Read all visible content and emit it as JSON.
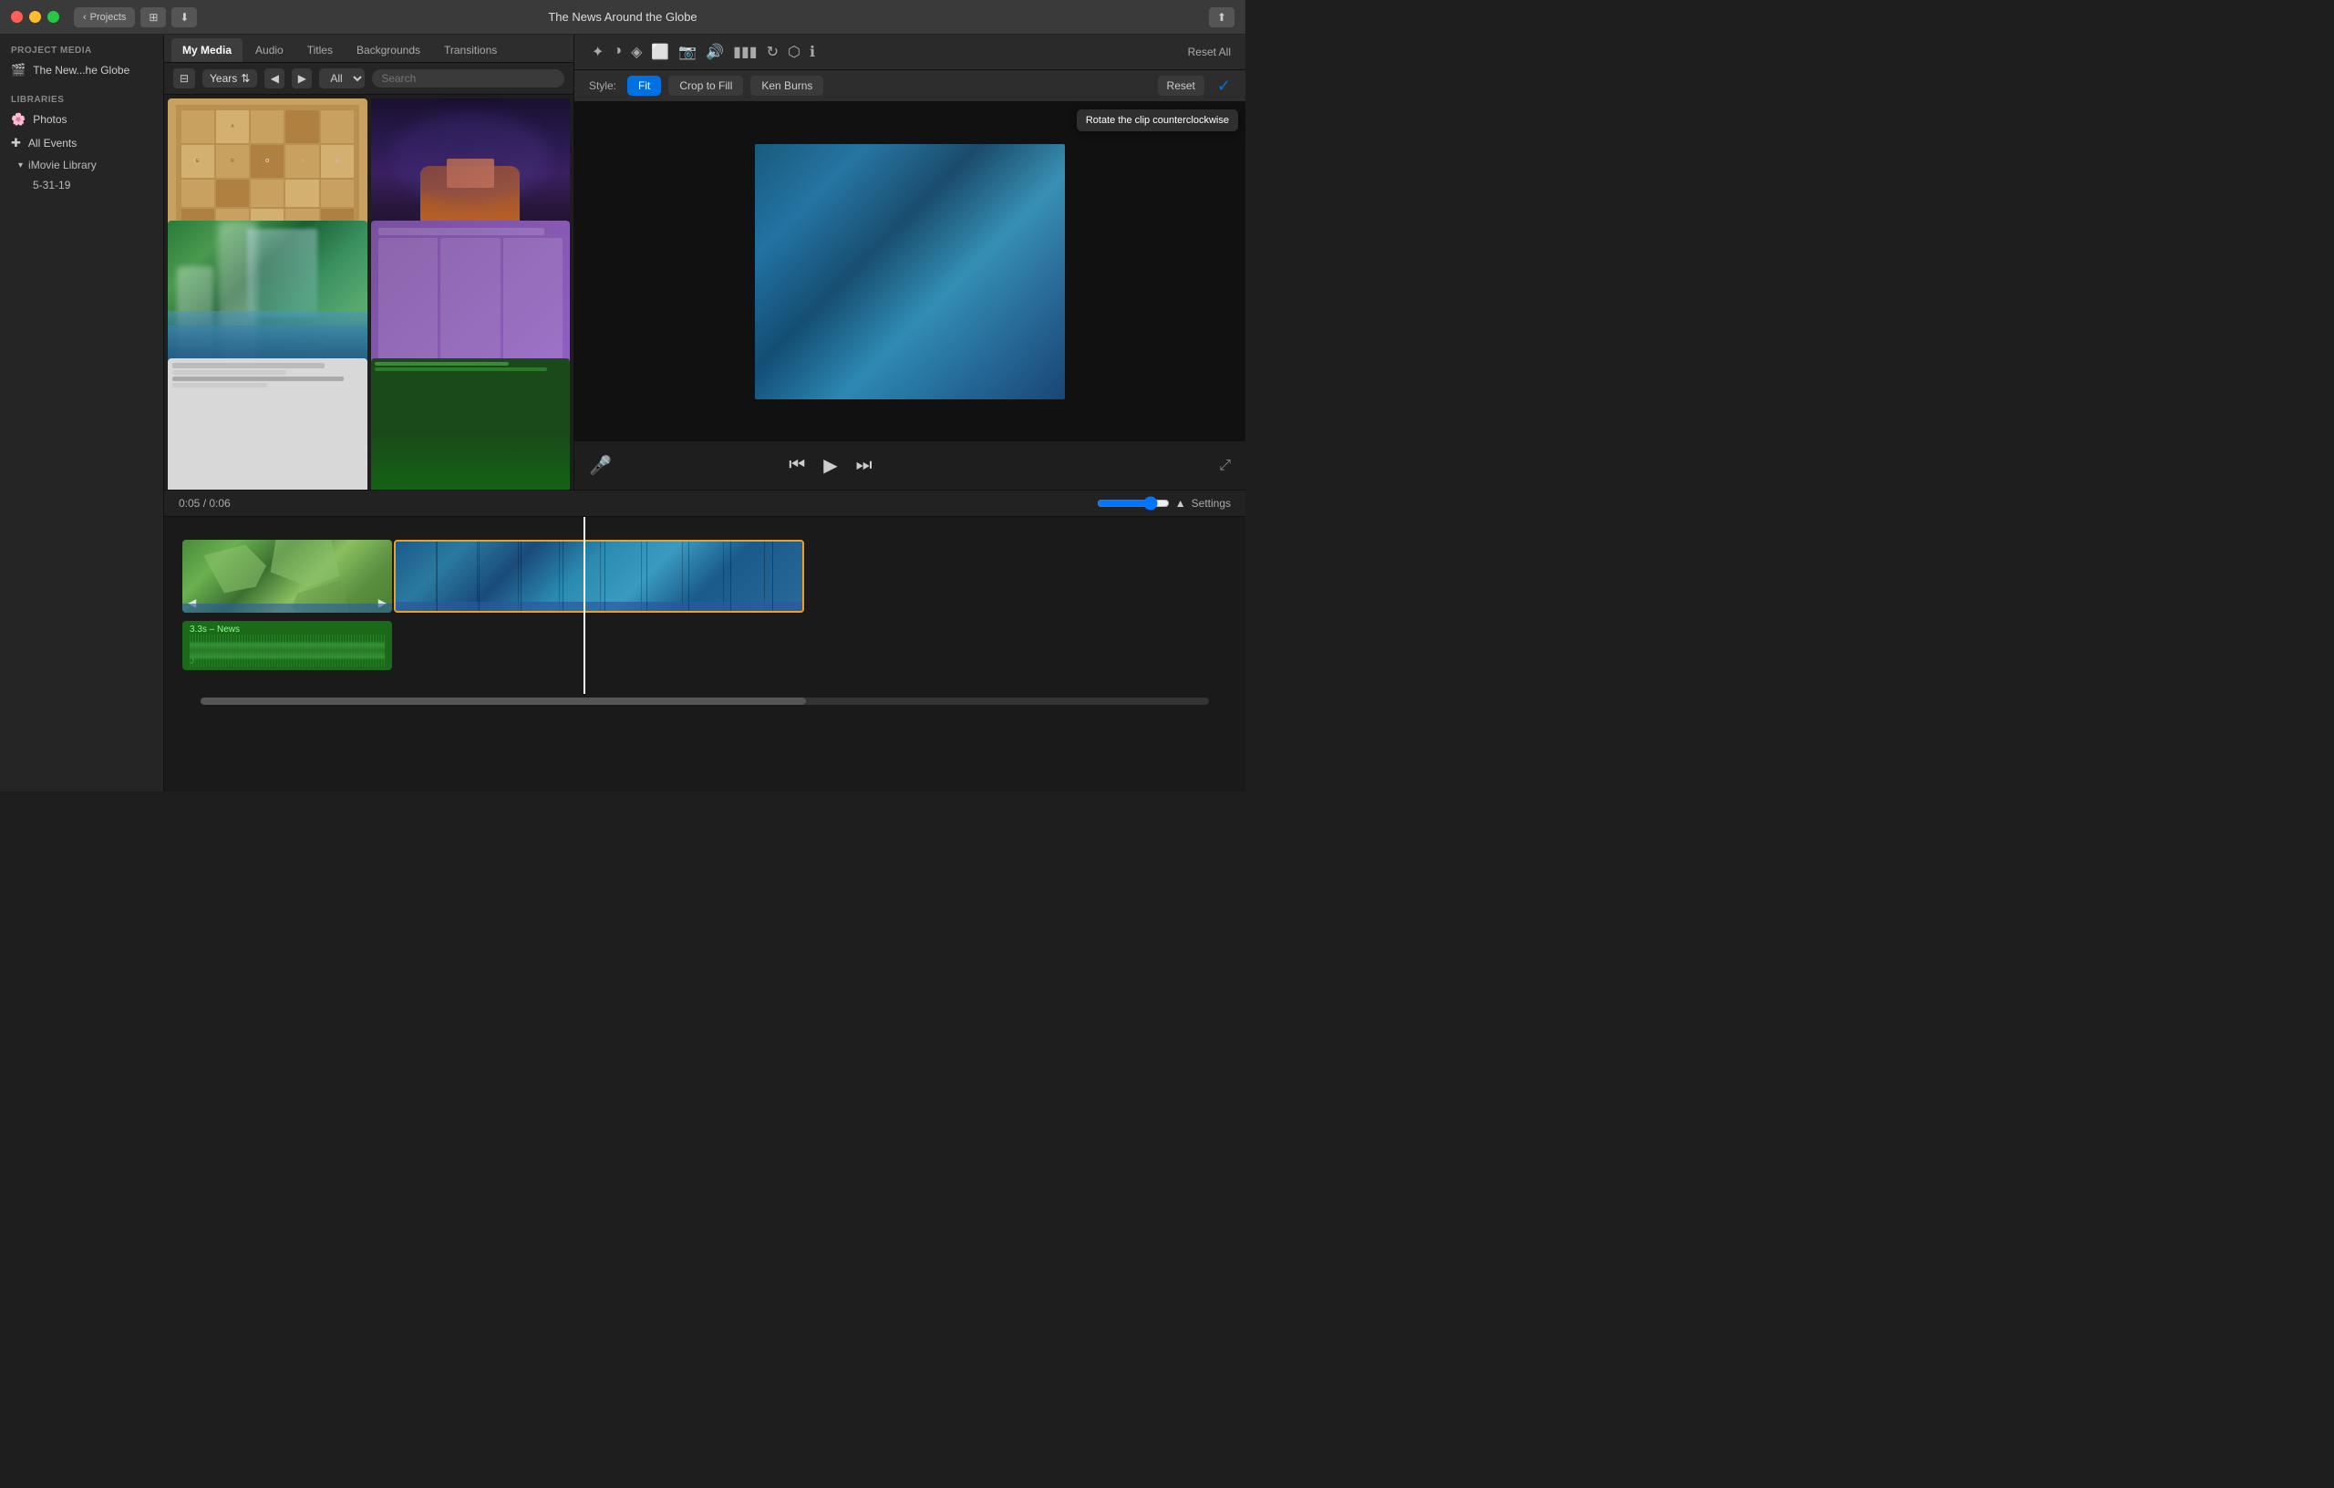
{
  "titlebar": {
    "title": "The News Around the Globe",
    "back_label": "Projects",
    "share_label": "⬆"
  },
  "media_tabs": [
    "My Media",
    "Audio",
    "Titles",
    "Backgrounds",
    "Transitions"
  ],
  "active_tab": "My Media",
  "media_filter": {
    "years_label": "Years",
    "filter_label": "All",
    "search_placeholder": "Search"
  },
  "preview": {
    "style_label": "Style:",
    "style_fit": "Fit",
    "style_crop": "Crop to Fill",
    "style_kenburns": "Ken Burns",
    "reset_label": "Reset",
    "reset_all_label": "Reset All",
    "tooltip": "Rotate the clip counterclockwise"
  },
  "timecode": {
    "current": "0:05",
    "total": "0:06",
    "separator": "/"
  },
  "settings_label": "Settings",
  "audio_clip_label": "3.3s – News",
  "toolbar_icons": [
    "✦",
    "◑",
    "◈",
    "⬜",
    "📷",
    "🔊",
    "▮▮▮",
    "↻",
    "⬡",
    "ℹ"
  ],
  "colors": {
    "accent_blue": "#0071e3",
    "timeline_gold": "#f0a020",
    "background_dark": "#1e1e1e",
    "sidebar_bg": "#252525"
  }
}
